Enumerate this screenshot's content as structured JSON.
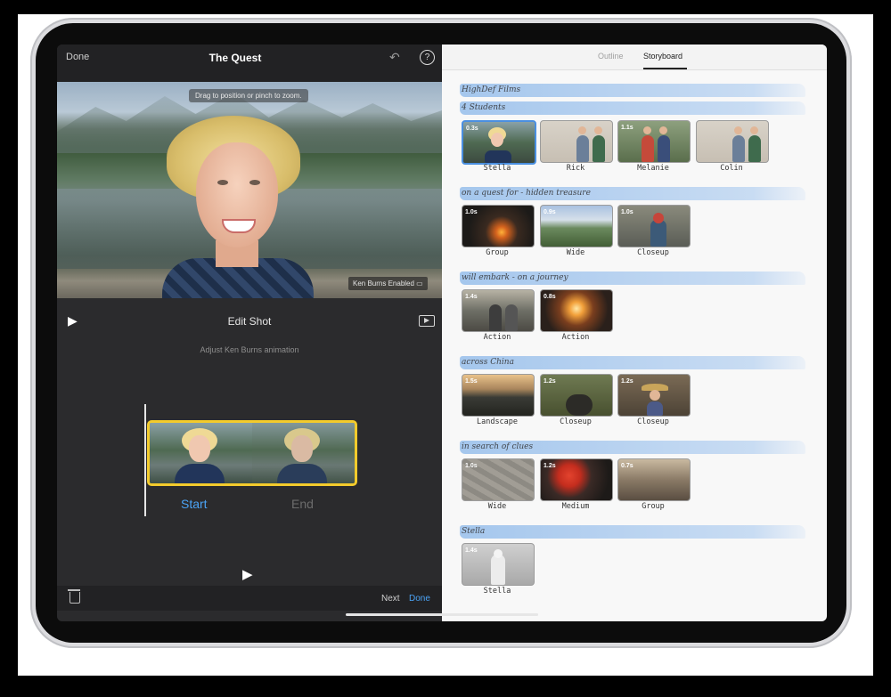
{
  "left_pane": {
    "done_top": "Done",
    "project_title": "The Quest",
    "undo_icon": "↶",
    "help_icon": "?",
    "viewer_hint": "Drag to position or pinch to zoom.",
    "ken_burns_badge": "Ken Burns Enabled",
    "edit_shot_label": "Edit Shot",
    "adjust_label": "Adjust Ken Burns animation",
    "start_label": "Start",
    "end_label": "End",
    "next_label": "Next",
    "done_bottom": "Done"
  },
  "right_pane": {
    "tabs": [
      {
        "label": "Outline",
        "selected": false
      },
      {
        "label": "Storyboard",
        "selected": true
      }
    ],
    "sections": [
      {
        "title": "HighDef Films"
      },
      {
        "title": "4 Students",
        "clips": [
          {
            "label": "Stella",
            "duration": "0.3s",
            "selected": true
          },
          {
            "label": "Rick",
            "duration": ""
          },
          {
            "label": "Melanie",
            "duration": "1.1s"
          },
          {
            "label": "Colin",
            "duration": ""
          }
        ]
      },
      {
        "title": "on a quest for - hidden treasure",
        "clips": [
          {
            "label": "Group",
            "duration": "1.0s"
          },
          {
            "label": "Wide",
            "duration": "0.9s"
          },
          {
            "label": "Closeup",
            "duration": "1.0s"
          }
        ]
      },
      {
        "title": "will embark - on a journey",
        "clips": [
          {
            "label": "Action",
            "duration": "1.4s"
          },
          {
            "label": "Action",
            "duration": "0.8s"
          }
        ]
      },
      {
        "title": "across China",
        "clips": [
          {
            "label": "Landscape",
            "duration": "1.5s"
          },
          {
            "label": "Closeup",
            "duration": "1.2s"
          },
          {
            "label": "Closeup",
            "duration": "1.2s"
          }
        ]
      },
      {
        "title": "in search of clues",
        "clips": [
          {
            "label": "Wide",
            "duration": "1.0s"
          },
          {
            "label": "Medium",
            "duration": "1.2s"
          },
          {
            "label": "Group",
            "duration": "0.7s"
          }
        ]
      },
      {
        "title": "Stella",
        "clips": [
          {
            "label": "Stella",
            "duration": "1.4s"
          }
        ]
      }
    ]
  }
}
